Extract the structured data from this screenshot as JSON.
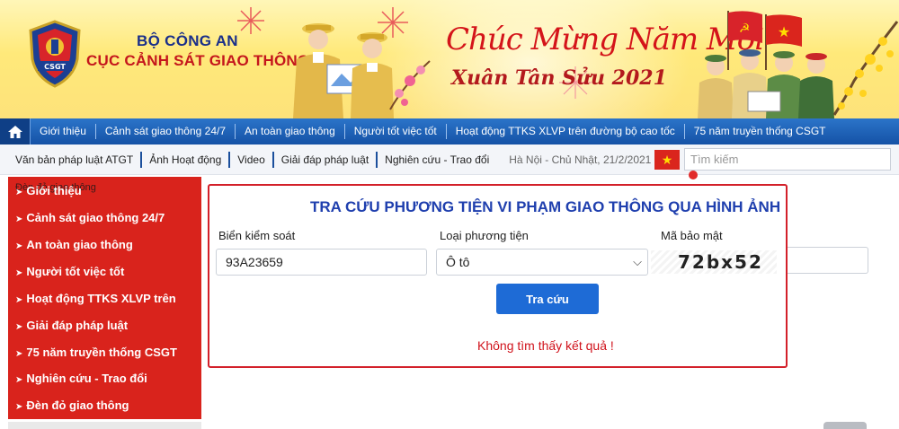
{
  "header": {
    "org_line1": "BỘ CÔNG AN",
    "org_line2": "CỤC CẢNH SÁT GIAO THÔNG",
    "logo_text": "CSGT",
    "greeting_line1": "Chúc Mừng Năm Mới",
    "greeting_line2": "Xuân Tân Sửu 2021"
  },
  "main_nav": {
    "items": [
      "Giới thiệu",
      "Cảnh sát giao thông 24/7",
      "An toàn giao thông",
      "Người tốt việc tốt",
      "Hoạt động TTKS XLVP trên đường bộ cao tốc",
      "75 năm truyền thống CSGT"
    ]
  },
  "sub_nav": {
    "items": [
      "Văn bản pháp luật ATGT",
      "Ảnh Hoạt động",
      "Video",
      "Giải đáp pháp luật",
      "Nghiên cứu - Trao đổi"
    ],
    "date": "Hà Nội - Chủ Nhật, 21/2/2021",
    "search_placeholder": "Tìm kiếm"
  },
  "sidebar": {
    "overlap_text": "Đèn đỏ giao thông",
    "items": [
      "Giới thiệu",
      "Cảnh sát giao thông 24/7",
      "An toàn giao thông",
      "Người tốt việc tốt",
      "Hoạt động TTKS XLVP trên",
      "Giải đáp pháp luật",
      "75 năm truyền thống CSGT",
      "Nghiên cứu - Trao đổi",
      "Đèn đỏ giao thông"
    ]
  },
  "lookup": {
    "title": "TRA CỨU PHƯƠNG TIỆN VI PHẠM GIAO THÔNG QUA HÌNH ẢNH",
    "plate_label": "Biển kiểm soát",
    "plate_value": "93A23659",
    "vehicle_label": "Loại phương tiện",
    "vehicle_value": "Ô tô",
    "captcha_label": "Mã bảo mật",
    "captcha_text": "72bx52",
    "submit_label": "Tra cứu",
    "result_message": "Không tìm thấy kết quả !"
  },
  "colors": {
    "nav_blue": "#1552a6",
    "sidebar_red": "#d9231c",
    "title_blue": "#1f3fae",
    "button_blue": "#1e6bd6",
    "error_red": "#d0121b"
  }
}
